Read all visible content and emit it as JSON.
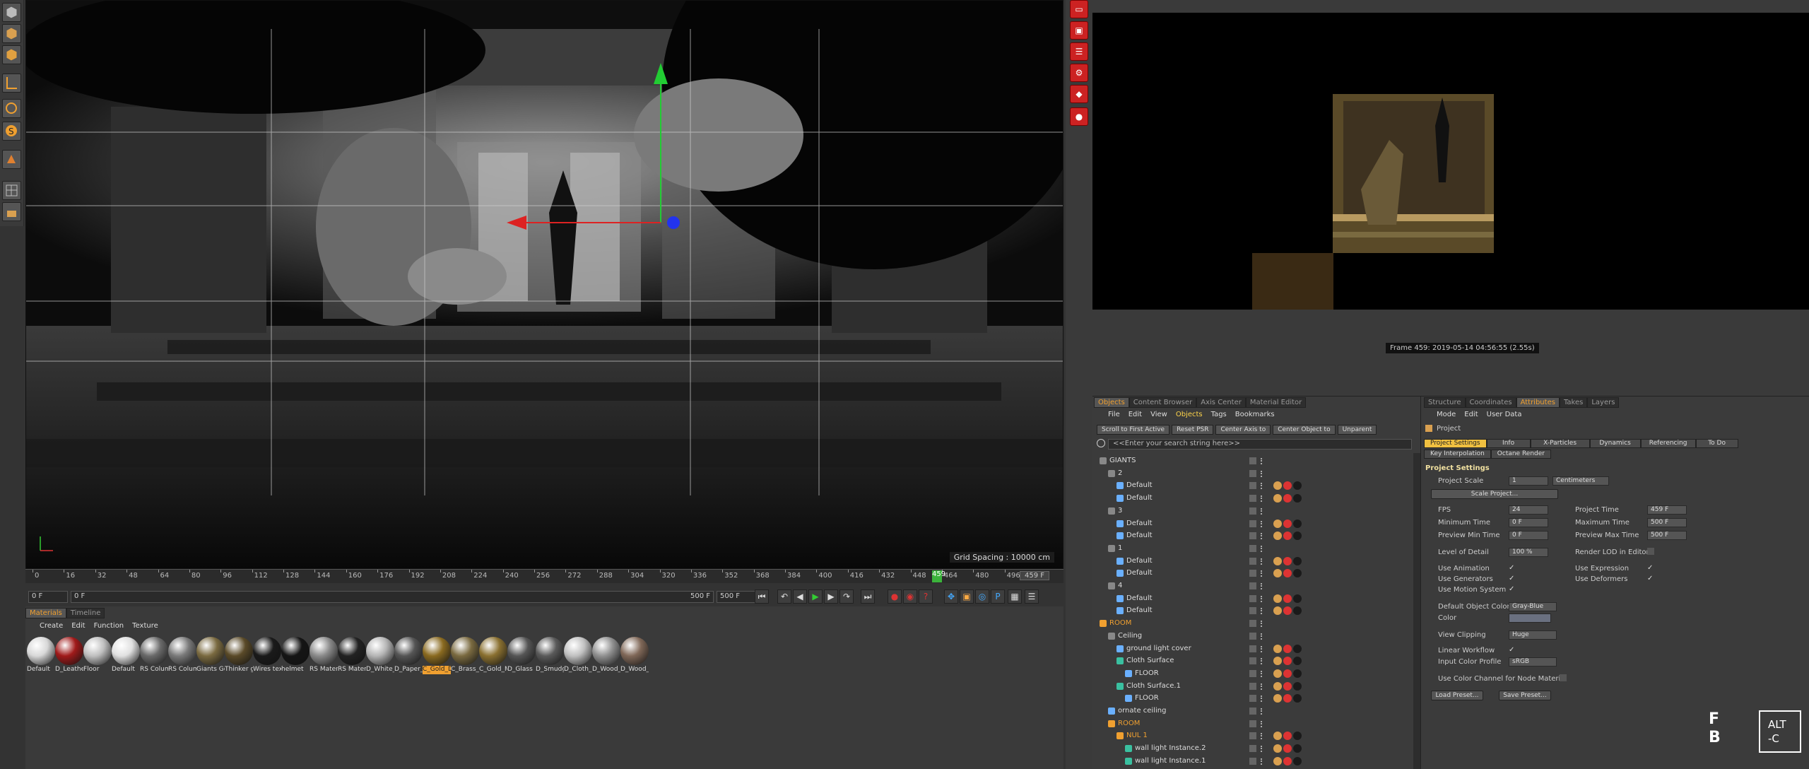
{
  "viewport": {
    "grid_spacing": "Grid Spacing : 10000 cm"
  },
  "timeline": {
    "ticks": [
      "0",
      "16",
      "32",
      "48",
      "64",
      "80",
      "96",
      "112",
      "128",
      "144",
      "160",
      "176",
      "192",
      "208",
      "224",
      "240",
      "256",
      "272",
      "288",
      "304",
      "320",
      "336",
      "352",
      "368",
      "384",
      "400",
      "416",
      "432",
      "448",
      "464",
      "480",
      "496"
    ],
    "current_frame": "459",
    "end_frame": "459 F",
    "start_field": "0 F",
    "min_field": "0 F",
    "max_field": "500 F",
    "max_field2": "500 F"
  },
  "materials": {
    "tabs": [
      "Materials",
      "Timeline"
    ],
    "menu": [
      "Create",
      "Edit",
      "Function",
      "Texture"
    ],
    "items": [
      {
        "label": "Default",
        "color": "#d8d8d8"
      },
      {
        "label": "D_Leather",
        "color": "#a01a1a"
      },
      {
        "label": "Floor",
        "color": "#bfbfbf"
      },
      {
        "label": "Default",
        "color": "#e0e0e0"
      },
      {
        "label": "RS Colum",
        "color": "#6a6a6a"
      },
      {
        "label": "RS Colum",
        "color": "#7a7a7a"
      },
      {
        "label": "Giants Gol",
        "color": "#7a6a40"
      },
      {
        "label": "Thinker go",
        "color": "#5a4a28"
      },
      {
        "label": "Wires text",
        "color": "#1a1a1a"
      },
      {
        "label": "helmet",
        "color": "#151515"
      },
      {
        "label": "RS Materia",
        "color": "#8a8a8a"
      },
      {
        "label": "RS Materia",
        "color": "#222222"
      },
      {
        "label": "D_White_P",
        "color": "#b5b5b5"
      },
      {
        "label": "D_Paper_Gl",
        "color": "#555555"
      },
      {
        "label": "C_Gold_Dar",
        "color": "#8a6a20"
      },
      {
        "label": "C_Brass_Sa",
        "color": "#7a6a40"
      },
      {
        "label": "C_Gold_Mi",
        "color": "#8a7030"
      },
      {
        "label": "D_Glass",
        "color": "#555555"
      },
      {
        "label": "D_Smudge",
        "color": "#5a5a5a"
      },
      {
        "label": "D_Cloth_W",
        "color": "#c0c0c0"
      },
      {
        "label": "D_Wood_P",
        "color": "#909090"
      },
      {
        "label": "D_Wood_P",
        "color": "#806858"
      }
    ],
    "selected_index": 14
  },
  "render": {
    "frame_info": "Frame 459: 2019-05-14 04:56:55 (2.55s)"
  },
  "objects": {
    "tabs": [
      "Objects",
      "Content Browser",
      "Axis Center",
      "Material Editor"
    ],
    "menu": [
      "File",
      "Edit",
      "View",
      "Objects",
      "Tags",
      "Bookmarks"
    ],
    "buttons": [
      "Scroll to First Active",
      "Reset PSR",
      "Center Axis to",
      "Center Object to",
      "Unparent"
    ],
    "search_placeholder": "<<Enter your search string here>>",
    "rows": [
      {
        "name": "GIANTS",
        "indent": 0,
        "color": "#888",
        "orange": false
      },
      {
        "name": "2",
        "indent": 1,
        "color": "#888",
        "orange": false
      },
      {
        "name": "Default",
        "indent": 2,
        "color": "#6ab0ff",
        "orange": false
      },
      {
        "name": "Default",
        "indent": 2,
        "color": "#6ab0ff",
        "orange": false
      },
      {
        "name": "3",
        "indent": 1,
        "color": "#888",
        "orange": false
      },
      {
        "name": "Default",
        "indent": 2,
        "color": "#6ab0ff",
        "orange": false
      },
      {
        "name": "Default",
        "indent": 2,
        "color": "#6ab0ff",
        "orange": false
      },
      {
        "name": "1",
        "indent": 1,
        "color": "#888",
        "orange": false
      },
      {
        "name": "Default",
        "indent": 2,
        "color": "#6ab0ff",
        "orange": false
      },
      {
        "name": "Default",
        "indent": 2,
        "color": "#6ab0ff",
        "orange": false
      },
      {
        "name": "4",
        "indent": 1,
        "color": "#888",
        "orange": false
      },
      {
        "name": "Default",
        "indent": 2,
        "color": "#6ab0ff",
        "orange": false
      },
      {
        "name": "Default",
        "indent": 2,
        "color": "#6ab0ff",
        "orange": false
      },
      {
        "name": "ROOM",
        "indent": 0,
        "color": "#f0a030",
        "orange": true
      },
      {
        "name": "Ceiling",
        "indent": 1,
        "color": "#888",
        "orange": false
      },
      {
        "name": "ground light cover",
        "indent": 2,
        "color": "#6ab0ff",
        "orange": false
      },
      {
        "name": "Cloth Surface",
        "indent": 2,
        "color": "#3ac0a0",
        "orange": false
      },
      {
        "name": "FLOOR",
        "indent": 3,
        "color": "#6ab0ff",
        "orange": false
      },
      {
        "name": "Cloth Surface.1",
        "indent": 2,
        "color": "#3ac0a0",
        "orange": false
      },
      {
        "name": "FLOOR",
        "indent": 3,
        "color": "#6ab0ff",
        "orange": false
      },
      {
        "name": "ornate ceiling",
        "indent": 1,
        "color": "#6ab0ff",
        "orange": false
      },
      {
        "name": "ROOM",
        "indent": 1,
        "color": "#f0a030",
        "orange": true
      },
      {
        "name": "NUL 1",
        "indent": 2,
        "color": "#f0a030",
        "orange": true
      },
      {
        "name": "wall light Instance.2",
        "indent": 3,
        "color": "#3ac0a0",
        "orange": false
      },
      {
        "name": "wall light Instance.1",
        "indent": 3,
        "color": "#3ac0a0",
        "orange": false
      }
    ]
  },
  "attributes": {
    "tabs": [
      "Structure",
      "Coordinates",
      "Attributes",
      "Takes",
      "Layers"
    ],
    "menu": [
      "Mode",
      "Edit",
      "User Data"
    ],
    "title": "Project",
    "subtabs": [
      "Project Settings",
      "Info",
      "X-Particles",
      "Dynamics",
      "Referencing",
      "To Do"
    ],
    "subtabs2": [
      "Key Interpolation",
      "Octane Render"
    ],
    "section": "Project Settings",
    "project_scale_label": "Project Scale",
    "project_scale_value": "1",
    "project_scale_unit": "Centimeters",
    "scale_project_btn": "Scale Project...",
    "fps_label": "FPS",
    "fps_value": "24",
    "min_time_label": "Minimum Time",
    "min_time_value": "0 F",
    "preview_min_label": "Preview Min Time",
    "preview_min_value": "0 F",
    "lod_label": "Level of Detail",
    "lod_value": "100 %",
    "project_time_label": "Project Time",
    "project_time_value": "459 F",
    "max_time_label": "Maximum Time",
    "max_time_value": "500 F",
    "preview_max_label": "Preview Max Time",
    "preview_max_value": "500 F",
    "render_lod_label": "Render LOD in Editor",
    "use_animation": "Use Animation",
    "use_generators": "Use Generators",
    "use_motion": "Use Motion System",
    "use_expression": "Use Expression",
    "use_deformers": "Use Deformers",
    "default_color_label": "Default Object Color",
    "default_color_value": "Gray-Blue",
    "color_label": "Color",
    "view_clipping_label": "View Clipping",
    "view_clipping_value": "Huge",
    "linear_workflow": "Linear Workflow",
    "input_color_label": "Input Color Profile",
    "input_color_value": "sRGB",
    "use_color_channel": "Use Color Channel for Node Material",
    "load_preset": "Load Preset...",
    "save_preset": "Save Preset..."
  },
  "logos": {
    "fb": "F B",
    "altc": "ALT\n-C"
  }
}
